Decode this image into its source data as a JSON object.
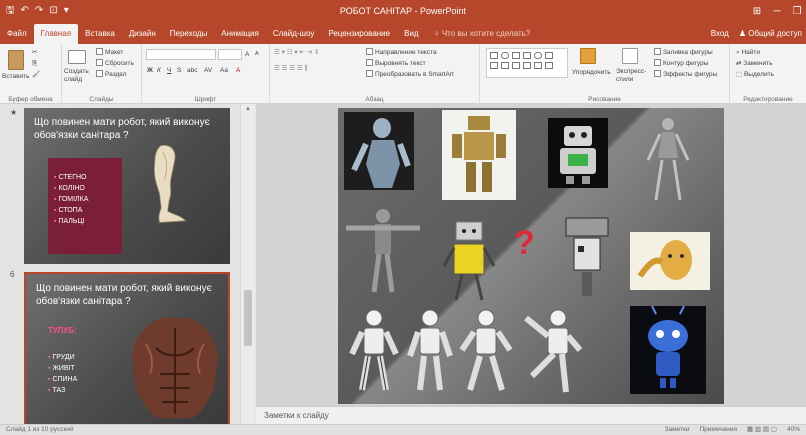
{
  "titlebar": {
    "title": "РОБОТ САНІТАР - PowerPoint",
    "qat": {
      "save": "🖫",
      "undo": "↶",
      "redo": "↷",
      "start": "⊡",
      "more": "▾"
    },
    "controls": {
      "ribbon_options": "⊞",
      "minimize": "─",
      "restore": "❐"
    }
  },
  "tabs": {
    "items": [
      "Файл",
      "Главная",
      "Вставка",
      "Дизайн",
      "Переходы",
      "Анимация",
      "Слайд-шоу",
      "Рецензирование",
      "Вид"
    ],
    "active_index": 1,
    "tell_me": "♀ Что вы хотите сделать?",
    "sign_in": "Вход",
    "share": "♟ Общий доступ"
  },
  "ribbon": {
    "clipboard": {
      "label": "Буфер обмена",
      "paste": "Вставить",
      "cut": "✂",
      "copy": "⎘",
      "format": "🖌"
    },
    "slides": {
      "label": "Слайды",
      "create": "Создать слайд",
      "layout": "Макет",
      "reset": "Сбросить",
      "section": "Раздел"
    },
    "font": {
      "label": "Шрифт",
      "bold": "Ж",
      "italic": "К",
      "underline": "Ч",
      "strike": "S",
      "shadow": "abc",
      "spacing": "AV",
      "case": "Aa",
      "color": "A",
      "grow": "A",
      "shrink": "A"
    },
    "paragraph": {
      "label": "Абзац",
      "direction": "Направление текста",
      "align": "Выровнять текст",
      "smartart": "Преобразовать в SmartArt"
    },
    "drawing": {
      "label": "Рисование",
      "arrange": "Упорядочить",
      "styles": "Экспресс-стили",
      "fill": "Заливка фигуры",
      "outline": "Контур фигуры",
      "effects": "Эффекты фигуры"
    },
    "editing": {
      "label": "Редактирование",
      "find": "Найти",
      "replace": "Заменить",
      "select": "Выделить"
    }
  },
  "thumbnails": [
    {
      "number": "",
      "title": "Що повинен мати робот, який виконує обов'язки санітара ?",
      "bullets": [
        "СТЕГНО",
        "КОЛІНО",
        "ГОМІЛКА",
        "СТОПА",
        "ПАЛЬЦІ"
      ]
    },
    {
      "number": "6",
      "title": "Що повинен мати робот, який виконує обов'язки санітара ?",
      "heading": "ТУЛУБ:",
      "bullets": [
        "ГРУДИ",
        "ЖИВІТ",
        "СПИНА",
        "ТАЗ"
      ]
    }
  ],
  "slide": {
    "question_mark": "?"
  },
  "notes": {
    "placeholder": "Заметки к слайду"
  },
  "status": {
    "slide_info": "Слайд 1 из 10",
    "language": "русский",
    "notes_btn": "Заметки",
    "comments_btn": "Примечания",
    "zoom": "40%"
  }
}
